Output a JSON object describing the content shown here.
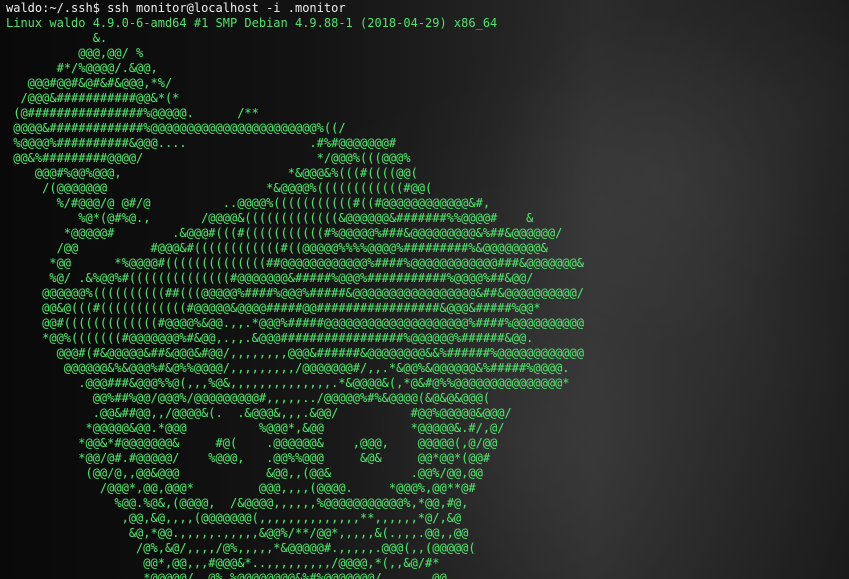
{
  "terminal": {
    "command_line": "waldo:~/.ssh$ ssh monitor@localhost -i .monitor",
    "kernel_line": "Linux waldo 4.9.0-6-amd64 #1 SMP Debian 4.9.88-1 (2018-04-29) x86_64",
    "ascii_art": "            &.\n          @@@,@@/ %\n       #*/%@@@@/.&@@,\n   @@@#@@#&@#&#&@@@,*%/\n  /@@@&###########@@&*(*\n (@################%@@@@@.      /**\n @@@@&#############%@@@@@@@@@@@@@@@@@@@@@@@%((/\n %@@@@%##########&@@@....                 .#%#@@@@@@@#\n @@&%#########@@@@/                        */@@@%(((@@@%\n    @@@#%@@%@@@,                       *&@@@&%(((#((((@@(\n     /(@@@@@@@                      *&@@@@%((((((((((((#@@(\n       %/#@@@/@ @#/@          ..@@@@%(((((((((((#((#@@@@@@@@@@@@&#,\n          %@*(@#%@.,       /@@@@&(((((((((((((&@@@@@@&#######%%@@@@#    &\n        *@@@@@#        .&@@@#(((#(((((((((((#%@@@@@%###&@@@@@@@@@&%##&@@@@@@/\n       /@@          #@@@&#((((((((((((#((@@@@@%%%%@@@@%#########%&@@@@@@@@&\n      *@@      *%@@@@#((((((((((((((##@@@@@@@@@@@@%####%@@@@@@@@@@@@###&@@@@@@@&\n      %@/ .&%@@%#((((((((((((((#@@@@@@@&#####%@@@%###########%@@@@%##&@@/\n     @@@@@@%((((((((((##(((@@@@@%####%@@@%#####&@@@@@@@@@@@@@@@@@&##&@@@@@@@@@@/\n     @@&@(((#((((((((((((#@@@@@&@@@@#####@@#################&@@@&#####%@@*\n     @@#(((((((((((((#@@@@%&@@.,,.*@@@%#####@@@@@@@@@@@@@@@@@@@@%####%@@@@@@@@@@\n     *@@%(((((((#@@@@@@@%#&@@,.,,.&@@@#################%@@@@@@%######&@@.\n       @@@#(#&@@@@@&##&@@@&#@@/,,,,,,,,@@@&######&@@@@@@@@&&%######%@@@@@@@@@@@@\n        @@@@@@&%&@@@%#&@%%@@@@/,,,,,,,,,/@@@@@@@#/,,.*&@@%&@@@@@@&%#####%@@@@.\n          .@@@###&@@@%%@(,,,%@&,,,,,,,,,,,,,,.*&@@@@&(,*@&#@%%@@@@@@@@@@@@@@@*\n            @@%##%@@/@@@%/@@@@@@@@@#,,,,,../@@@@@%#%&@@@@(&@&@&@@@(\n            .@@&##@@,,/@@@@&(.  .&@@@&,,,.&@@/          #@@%@@@@@&@@@/\n           *@@@@@&@@.*@@@          %@@@*,&@@            *@@@@@&.#/,@/\n          *@@&*#@@@@@@@&     #@(    .@@@@@@&    ,@@@,    @@@@@(,@/@@\n          *@@/@#.#@@@@@/    %@@@,   .@@%%@@@     &@&     @@*@@*(@@#\n           (@@/@,,@@&@@@            &@@,,(@@&           .@@%/@@,@@\n             /@@@*,@@,@@@*         @@@,,,,(@@@@.     *@@@%,@@**@#\n               %@@.%@&,(@@@@,  /&@@@@,,,,,,%@@@@@@@@@@@%,*@@,#@,\n                ,@@,&@,,,,(@@@@@@@(,,,,,,,,,,,,,,**,,,,,,*@/,&@\n                 &@,*@@.,,,,,.,,,,,&@@%/**/@@*,,,,,&(.,,,.@@,,@@\n                  /@%,&@/,,,,/@%,,,,,*&@@@@@#.,,,,,.@@@(,,(@@@@@(\n                   @@*,@@,,,#@@@&*..,,,,,,,,,/@@@@,*(,,&@/#*\n                   *@@@@@/  @%,%@@@@@@@@&%#%@@@@@@@/       @@"
  },
  "colors": {
    "prompt_text": "#f0f0f0",
    "green_text": "#4fe26c",
    "background": "#0b0b0b"
  }
}
